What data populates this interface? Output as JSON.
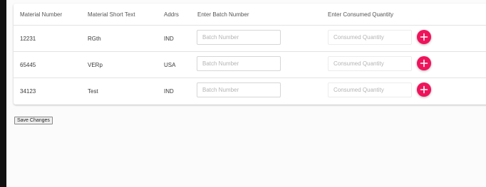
{
  "table": {
    "headers": {
      "material_number": "Material Number",
      "material_short_text": "Material Short Text",
      "addrs": "Addrs",
      "batch_number": "Enter Batch Number",
      "consumed_quantity": "Enter Consumed Quantity"
    },
    "rows": [
      {
        "material_number": "12231",
        "short_text": "RGth",
        "addrs": "IND",
        "batch_value": "",
        "quantity_value": ""
      },
      {
        "material_number": "65445",
        "short_text": "VERp",
        "addrs": "USA",
        "batch_value": "",
        "quantity_value": ""
      },
      {
        "material_number": "34123",
        "short_text": "Test",
        "addrs": "IND",
        "batch_value": "",
        "quantity_value": ""
      }
    ],
    "batch_placeholder": "Batch Number",
    "quantity_placeholder": "Consumed Quantity",
    "add_icon": "plus-icon"
  },
  "actions": {
    "save_label": "Save Changes"
  },
  "colors": {
    "accent": "#f0135c"
  }
}
